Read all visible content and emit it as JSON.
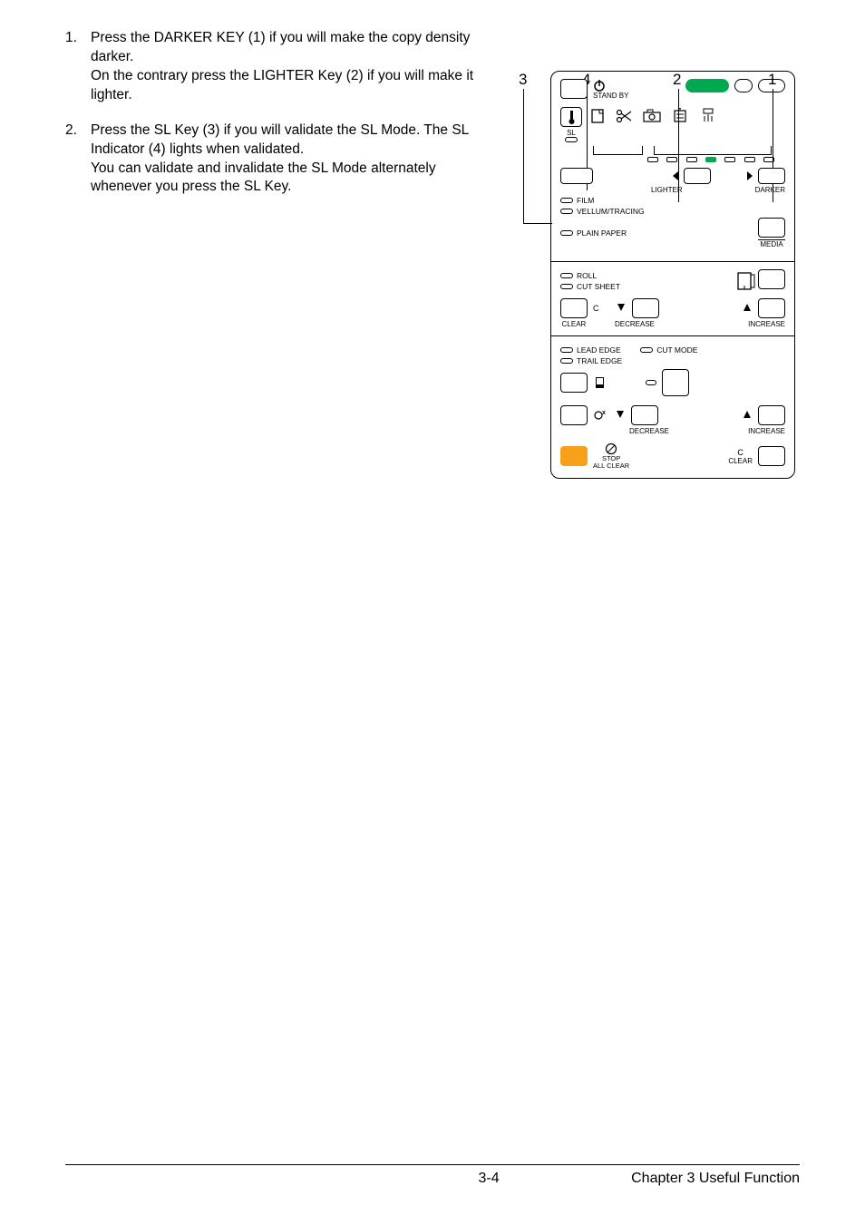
{
  "instructions": [
    {
      "n": "1.",
      "a": "Press the DARKER KEY (1) if you will make the copy density darker.",
      "b": "On the contrary press the LIGHTER Key (2) if you will make it lighter."
    },
    {
      "n": "2.",
      "a": "Press the SL Key (3) if you will validate the SL Mode. The SL Indicator (4) lights when validated.",
      "b": "You can validate and invalidate the SL Mode alternately whenever you press the SL Key."
    }
  ],
  "pointers": {
    "p1": "1",
    "p2": "2",
    "p3": "3",
    "p4": "4"
  },
  "panel": {
    "standby": "STAND BY",
    "sl": "SL",
    "lighter": "LIGHTER",
    "darker": "DARKER",
    "film": "FILM",
    "vellum": "VELLUM/TRACING",
    "plain": "PLAIN PAPER",
    "media": "MEDIA",
    "roll": "ROLL",
    "cutsheet": "CUT SHEET",
    "c": "C",
    "clear": "CLEAR",
    "decrease": "DECREASE",
    "increase": "INCREASE",
    "leadedge": "LEAD EDGE",
    "trailedge": "TRAIL EDGE",
    "cutmode": "CUT MODE",
    "stop": "STOP",
    "allclear": "ALL CLEAR"
  },
  "footer": {
    "page": "3-4",
    "chapter": "Chapter 3    Useful Function"
  }
}
